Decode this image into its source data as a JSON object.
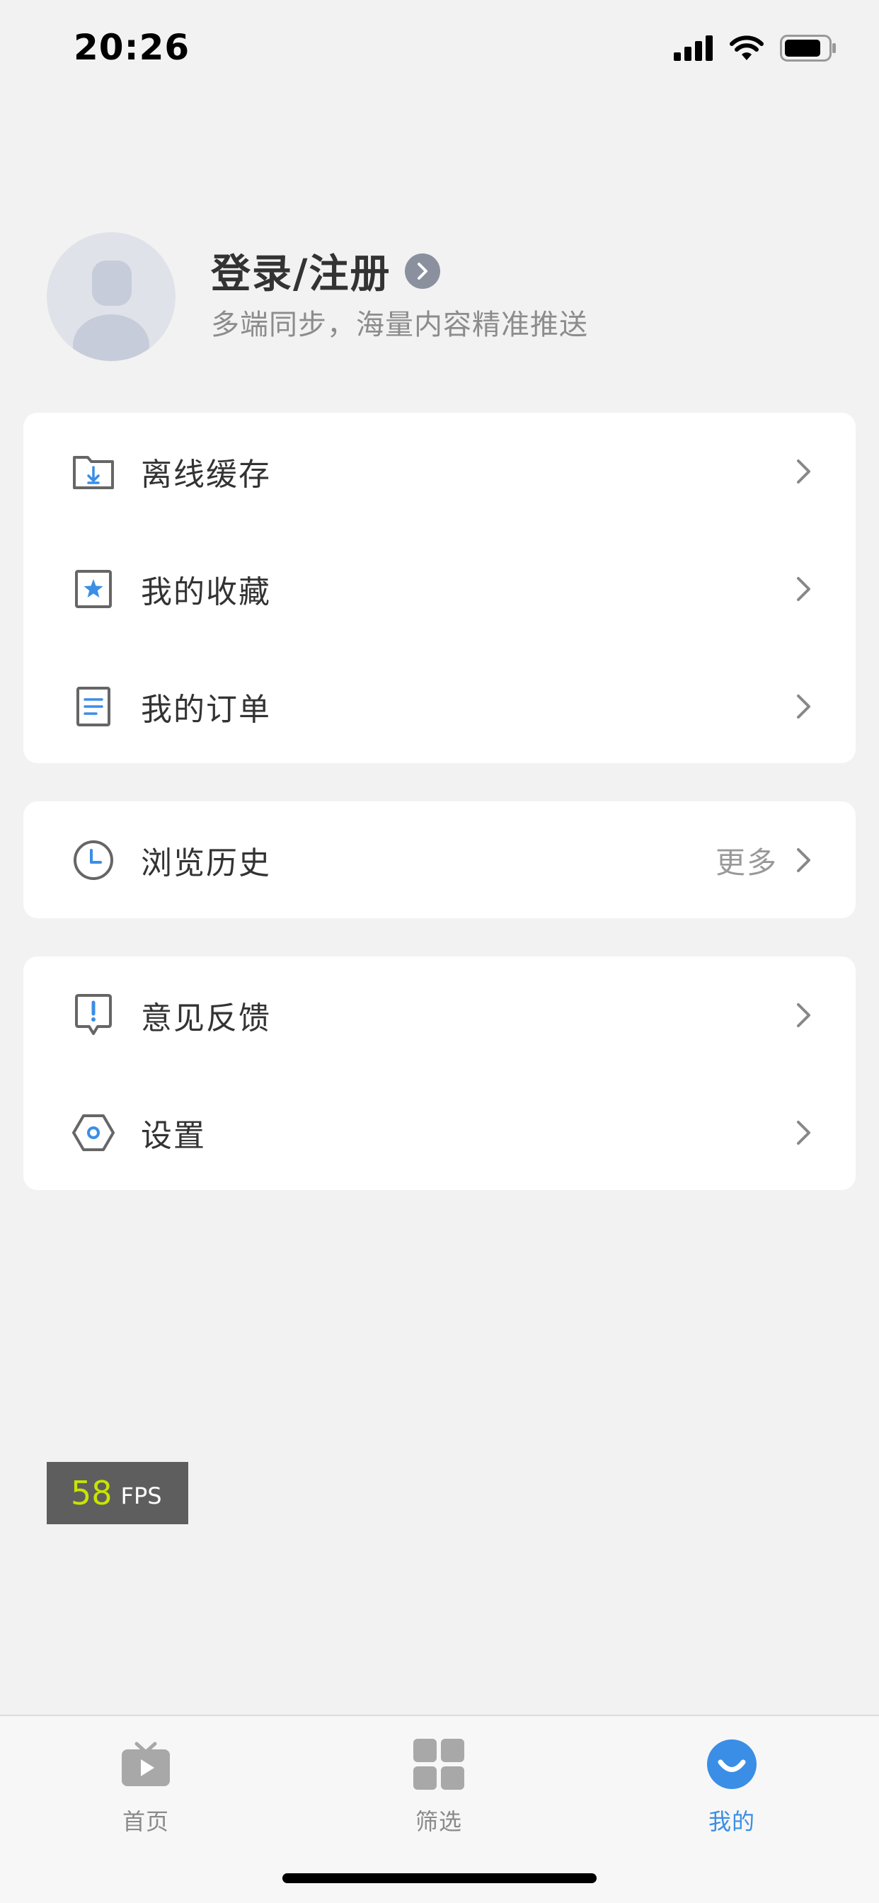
{
  "status_bar": {
    "time": "20:26"
  },
  "profile": {
    "title": "登录/注册",
    "subtitle": "多端同步，海量内容精准推送"
  },
  "menu_group_1": {
    "items": [
      {
        "label": "离线缓存",
        "icon": "offline-download-icon"
      },
      {
        "label": "我的收藏",
        "icon": "star-favorite-icon"
      },
      {
        "label": "我的订单",
        "icon": "order-document-icon"
      }
    ]
  },
  "menu_group_2": {
    "items": [
      {
        "label": "浏览历史",
        "icon": "clock-history-icon",
        "more": "更多"
      }
    ]
  },
  "menu_group_3": {
    "items": [
      {
        "label": "意见反馈",
        "icon": "feedback-icon"
      },
      {
        "label": "设置",
        "icon": "settings-hexagon-icon"
      }
    ]
  },
  "fps": {
    "value": "58",
    "label": "FPS"
  },
  "tabbar": {
    "tabs": [
      {
        "label": "首页",
        "icon": "tv-play-icon",
        "active": false
      },
      {
        "label": "筛选",
        "icon": "grid-filter-icon",
        "active": false
      },
      {
        "label": "我的",
        "icon": "smile-profile-icon",
        "active": true
      }
    ]
  },
  "colors": {
    "accent": "#3a8ee6",
    "background": "#f2f2f2",
    "card": "#ffffff",
    "text": "#333333",
    "muted": "#999999",
    "fps_value": "#c8e400"
  }
}
